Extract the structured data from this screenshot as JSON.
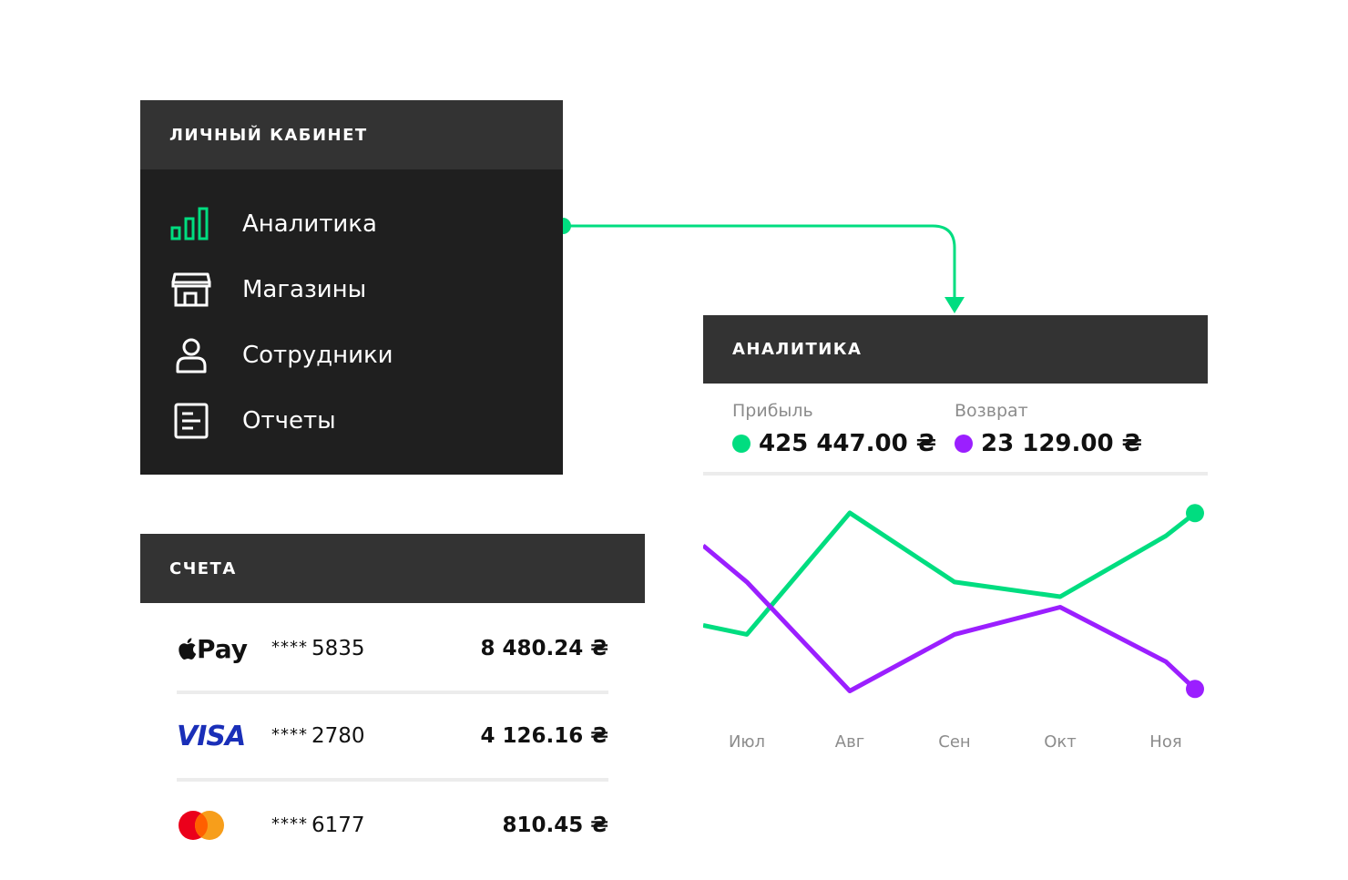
{
  "cabinet": {
    "title": "ЛИЧНЫЙ КАБИНЕТ",
    "items": [
      {
        "label": "Аналитика",
        "icon": "bar-chart-icon",
        "active": true
      },
      {
        "label": "Магазины",
        "icon": "store-icon",
        "active": false
      },
      {
        "label": "Сотрудники",
        "icon": "user-icon",
        "active": false
      },
      {
        "label": "Отчеты",
        "icon": "document-icon",
        "active": false
      }
    ]
  },
  "analytics": {
    "title": "АНАЛИТИКА",
    "profit": {
      "label": "Прибыль",
      "value": "425 447.00 ₴",
      "color": "#00dd80"
    },
    "refund": {
      "label": "Возврат",
      "value": "23 129.00 ₴",
      "color": "#9b1fff"
    }
  },
  "chart_data": {
    "type": "line",
    "categories": [
      "Июл",
      "Авг",
      "Сен",
      "Окт",
      "Ноя"
    ],
    "series": [
      {
        "name": "Прибыль",
        "color": "#00dd80",
        "values": [
          32,
          90,
          57,
          50,
          79
        ]
      },
      {
        "name": "Возврат",
        "color": "#9b1fff",
        "values": [
          57,
          5,
          32,
          45,
          19
        ]
      }
    ],
    "ylim": [
      0,
      100
    ],
    "grid": false,
    "legend": "none"
  },
  "accounts": {
    "title": "СЧЕТА",
    "rows": [
      {
        "logo": "apple-pay-logo",
        "brand": "Pay",
        "stars": "****",
        "number": "5835",
        "amount": "8 480.24 ₴"
      },
      {
        "logo": "visa-logo",
        "brand": "VISA",
        "stars": "****",
        "number": "2780",
        "amount": "4 126.16 ₴"
      },
      {
        "logo": "mastercard-logo",
        "brand": "",
        "stars": "****",
        "number": "6177",
        "amount": "810.45 ₴"
      }
    ]
  },
  "colors": {
    "accent": "#00dd80",
    "purple": "#9b1fff",
    "panel_dark": "#1f1f1f",
    "panel_head": "#333333"
  }
}
